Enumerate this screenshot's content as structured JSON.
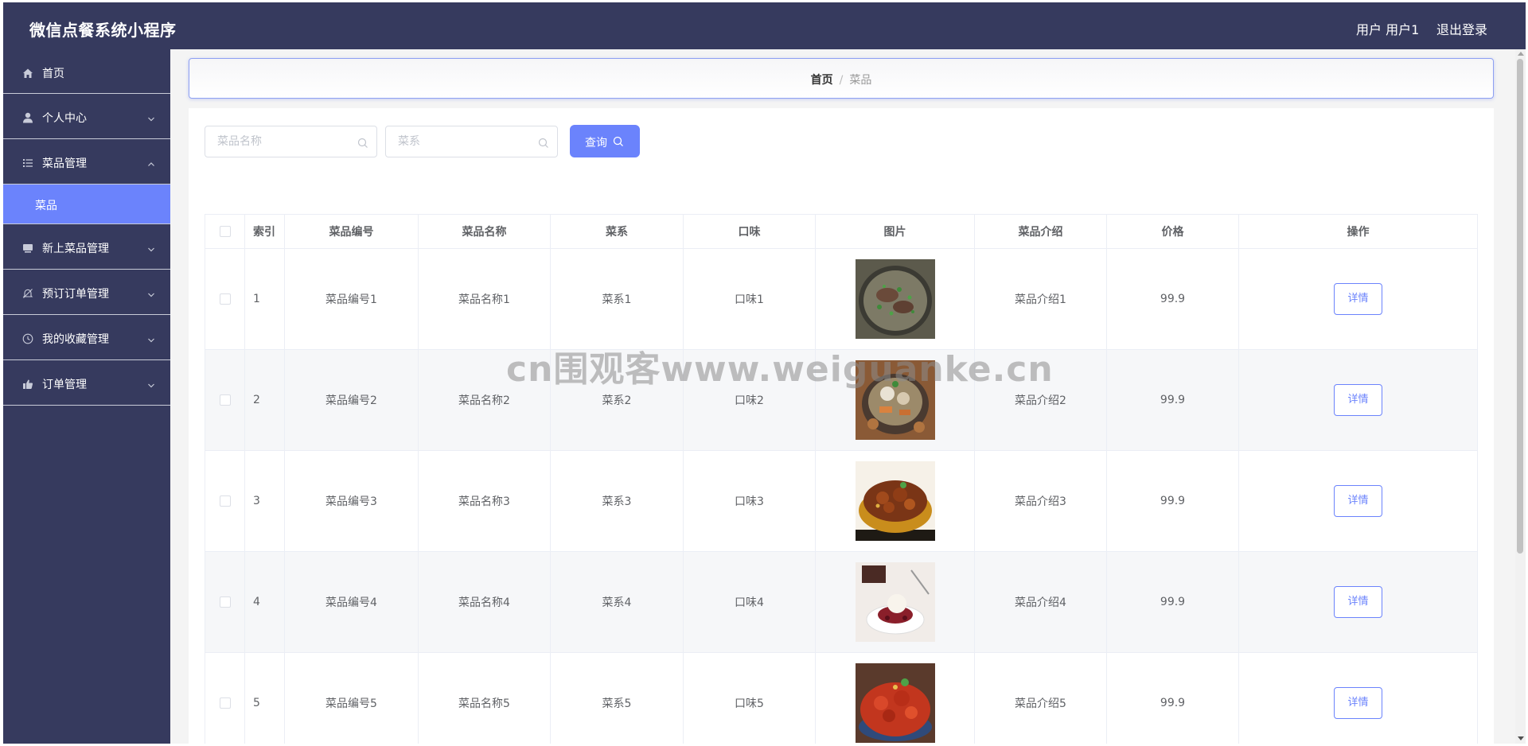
{
  "header": {
    "app_title": "微信点餐系统小程序",
    "user_label": "用户 用户1",
    "logout_label": "退出登录"
  },
  "sidebar": {
    "items": [
      {
        "label": "首页",
        "icon": "home-icon"
      },
      {
        "label": "个人中心",
        "icon": "user-icon",
        "expanded": false
      },
      {
        "label": "菜品管理",
        "icon": "list-icon",
        "expanded": true,
        "children": [
          {
            "label": "菜品",
            "active": true
          }
        ]
      },
      {
        "label": "新上菜品管理",
        "icon": "monitor-icon",
        "expanded": false
      },
      {
        "label": "预订订单管理",
        "icon": "bell-off-icon",
        "expanded": false
      },
      {
        "label": "我的收藏管理",
        "icon": "clock-icon",
        "expanded": false
      },
      {
        "label": "订单管理",
        "icon": "thumb-up-icon",
        "expanded": false
      }
    ]
  },
  "breadcrumb": {
    "home": "首页",
    "separator": "/",
    "current": "菜品"
  },
  "search": {
    "name_placeholder": "菜品名称",
    "cuisine_placeholder": "菜系",
    "query_label": "查询"
  },
  "table": {
    "columns": [
      "索引",
      "菜品编号",
      "菜品名称",
      "菜系",
      "口味",
      "图片",
      "菜品介绍",
      "价格",
      "操作"
    ],
    "detail_label": "详情",
    "rows": [
      {
        "index": "1",
        "code": "菜品编号1",
        "name": "菜品名称1",
        "cuisine": "菜系1",
        "taste": "口味1",
        "image": "soup-bowl-image",
        "intro": "菜品介绍1",
        "price": "99.9"
      },
      {
        "index": "2",
        "code": "菜品编号2",
        "name": "菜品名称2",
        "cuisine": "菜系2",
        "taste": "口味2",
        "image": "stew-pot-image",
        "intro": "菜品介绍2",
        "price": "99.9"
      },
      {
        "index": "3",
        "code": "菜品编号3",
        "name": "菜品名称3",
        "cuisine": "菜系3",
        "taste": "口味3",
        "image": "braised-chicken-image",
        "intro": "菜品介绍3",
        "price": "99.9"
      },
      {
        "index": "4",
        "code": "菜品编号4",
        "name": "菜品名称4",
        "cuisine": "菜系4",
        "taste": "口味4",
        "image": "dessert-image",
        "intro": "菜品介绍4",
        "price": "99.9"
      },
      {
        "index": "5",
        "code": "菜品编号5",
        "name": "菜品名称5",
        "cuisine": "菜系5",
        "taste": "口味5",
        "image": "crayfish-image",
        "intro": "菜品介绍5",
        "price": "99.9"
      }
    ]
  },
  "watermark": "cn围观客www.weiguanke.cn",
  "colors": {
    "nav_bg": "#363a5e",
    "accent": "#6b83fc",
    "stripe_bg": "#f6f7f9"
  }
}
